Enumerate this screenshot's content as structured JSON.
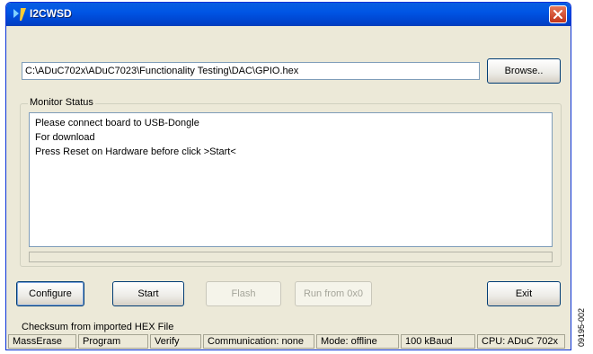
{
  "window": {
    "title": "I2CWSD",
    "title_color": "#0055e5"
  },
  "file": {
    "path": "C:\\ADuC702x\\ADuC7023\\Functionality Testing\\DAC\\GPIO.hex",
    "browse_label": "Browse.."
  },
  "monitor": {
    "label": "Monitor Status",
    "lines": [
      "Please connect board to USB-Dongle",
      "For download",
      "Press Reset on Hardware before click >Start<"
    ],
    "progress": 0
  },
  "buttons": {
    "configure": "Configure",
    "start": "Start",
    "flash": "Flash",
    "run": "Run from 0x0",
    "exit": "Exit"
  },
  "info_text": "Checksum from imported HEX File",
  "statusbar": {
    "mass_erase": "MassErase",
    "program": "Program",
    "verify": "Verify",
    "communication": "Communication: none",
    "mode": "Mode: offline",
    "baud": "100 kBaud",
    "cpu": "CPU: ADuC 702x"
  },
  "figure_id": "09195-002"
}
